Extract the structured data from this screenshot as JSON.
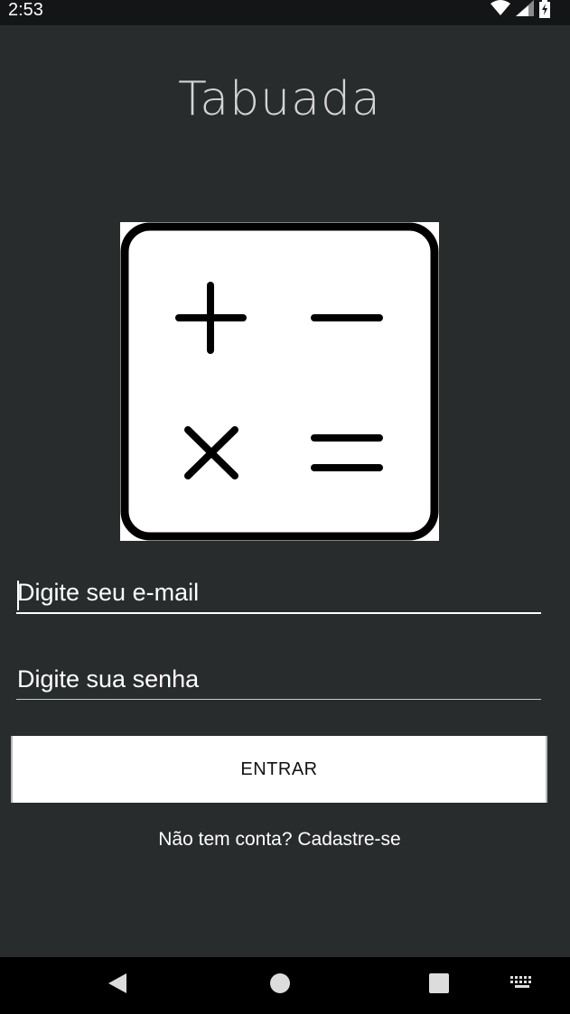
{
  "status_bar": {
    "time": "2:53",
    "icons": [
      "wifi-icon",
      "signal-icon",
      "battery-charging-icon"
    ]
  },
  "app": {
    "title": "Tabuada",
    "logo_icon": "calculator-operations-icon"
  },
  "login_form": {
    "email_placeholder": "Digite seu e-mail",
    "email_value": "",
    "password_placeholder": "Digite sua senha",
    "password_value": "",
    "submit_label": "ENTRAR",
    "signup_link": "Não tem conta? Cadastre-se"
  },
  "nav_bar": {
    "buttons": [
      "back-icon",
      "home-icon",
      "recents-icon",
      "keyboard-icon"
    ]
  },
  "colors": {
    "background": "#282c2d",
    "status_bar": "#131516",
    "nav_bar": "#000000",
    "button": "#ffffff",
    "text": "#ffffff"
  }
}
